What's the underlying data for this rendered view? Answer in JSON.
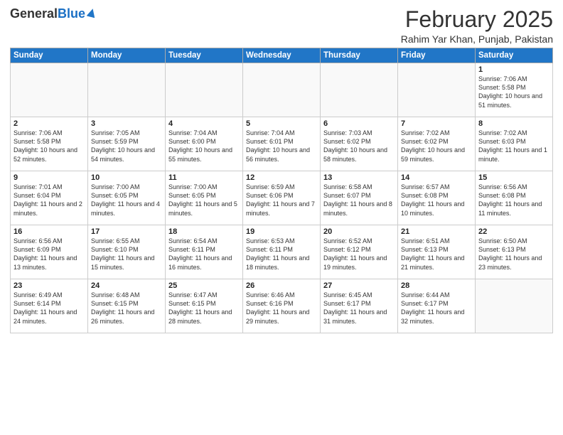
{
  "header": {
    "logo_general": "General",
    "logo_blue": "Blue",
    "month_title": "February 2025",
    "location": "Rahim Yar Khan, Punjab, Pakistan"
  },
  "weekdays": [
    "Sunday",
    "Monday",
    "Tuesday",
    "Wednesday",
    "Thursday",
    "Friday",
    "Saturday"
  ],
  "weeks": [
    [
      {
        "day": "",
        "sunrise": "",
        "sunset": "",
        "daylight": ""
      },
      {
        "day": "",
        "sunrise": "",
        "sunset": "",
        "daylight": ""
      },
      {
        "day": "",
        "sunrise": "",
        "sunset": "",
        "daylight": ""
      },
      {
        "day": "",
        "sunrise": "",
        "sunset": "",
        "daylight": ""
      },
      {
        "day": "",
        "sunrise": "",
        "sunset": "",
        "daylight": ""
      },
      {
        "day": "",
        "sunrise": "",
        "sunset": "",
        "daylight": ""
      },
      {
        "day": "1",
        "sunrise": "Sunrise: 7:06 AM",
        "sunset": "Sunset: 5:58 PM",
        "daylight": "Daylight: 10 hours and 51 minutes."
      }
    ],
    [
      {
        "day": "2",
        "sunrise": "Sunrise: 7:06 AM",
        "sunset": "Sunset: 5:58 PM",
        "daylight": "Daylight: 10 hours and 52 minutes."
      },
      {
        "day": "3",
        "sunrise": "Sunrise: 7:05 AM",
        "sunset": "Sunset: 5:59 PM",
        "daylight": "Daylight: 10 hours and 54 minutes."
      },
      {
        "day": "4",
        "sunrise": "Sunrise: 7:04 AM",
        "sunset": "Sunset: 6:00 PM",
        "daylight": "Daylight: 10 hours and 55 minutes."
      },
      {
        "day": "5",
        "sunrise": "Sunrise: 7:04 AM",
        "sunset": "Sunset: 6:01 PM",
        "daylight": "Daylight: 10 hours and 56 minutes."
      },
      {
        "day": "6",
        "sunrise": "Sunrise: 7:03 AM",
        "sunset": "Sunset: 6:02 PM",
        "daylight": "Daylight: 10 hours and 58 minutes."
      },
      {
        "day": "7",
        "sunrise": "Sunrise: 7:02 AM",
        "sunset": "Sunset: 6:02 PM",
        "daylight": "Daylight: 10 hours and 59 minutes."
      },
      {
        "day": "8",
        "sunrise": "Sunrise: 7:02 AM",
        "sunset": "Sunset: 6:03 PM",
        "daylight": "Daylight: 11 hours and 1 minute."
      }
    ],
    [
      {
        "day": "9",
        "sunrise": "Sunrise: 7:01 AM",
        "sunset": "Sunset: 6:04 PM",
        "daylight": "Daylight: 11 hours and 2 minutes."
      },
      {
        "day": "10",
        "sunrise": "Sunrise: 7:00 AM",
        "sunset": "Sunset: 6:05 PM",
        "daylight": "Daylight: 11 hours and 4 minutes."
      },
      {
        "day": "11",
        "sunrise": "Sunrise: 7:00 AM",
        "sunset": "Sunset: 6:05 PM",
        "daylight": "Daylight: 11 hours and 5 minutes."
      },
      {
        "day": "12",
        "sunrise": "Sunrise: 6:59 AM",
        "sunset": "Sunset: 6:06 PM",
        "daylight": "Daylight: 11 hours and 7 minutes."
      },
      {
        "day": "13",
        "sunrise": "Sunrise: 6:58 AM",
        "sunset": "Sunset: 6:07 PM",
        "daylight": "Daylight: 11 hours and 8 minutes."
      },
      {
        "day": "14",
        "sunrise": "Sunrise: 6:57 AM",
        "sunset": "Sunset: 6:08 PM",
        "daylight": "Daylight: 11 hours and 10 minutes."
      },
      {
        "day": "15",
        "sunrise": "Sunrise: 6:56 AM",
        "sunset": "Sunset: 6:08 PM",
        "daylight": "Daylight: 11 hours and 11 minutes."
      }
    ],
    [
      {
        "day": "16",
        "sunrise": "Sunrise: 6:56 AM",
        "sunset": "Sunset: 6:09 PM",
        "daylight": "Daylight: 11 hours and 13 minutes."
      },
      {
        "day": "17",
        "sunrise": "Sunrise: 6:55 AM",
        "sunset": "Sunset: 6:10 PM",
        "daylight": "Daylight: 11 hours and 15 minutes."
      },
      {
        "day": "18",
        "sunrise": "Sunrise: 6:54 AM",
        "sunset": "Sunset: 6:11 PM",
        "daylight": "Daylight: 11 hours and 16 minutes."
      },
      {
        "day": "19",
        "sunrise": "Sunrise: 6:53 AM",
        "sunset": "Sunset: 6:11 PM",
        "daylight": "Daylight: 11 hours and 18 minutes."
      },
      {
        "day": "20",
        "sunrise": "Sunrise: 6:52 AM",
        "sunset": "Sunset: 6:12 PM",
        "daylight": "Daylight: 11 hours and 19 minutes."
      },
      {
        "day": "21",
        "sunrise": "Sunrise: 6:51 AM",
        "sunset": "Sunset: 6:13 PM",
        "daylight": "Daylight: 11 hours and 21 minutes."
      },
      {
        "day": "22",
        "sunrise": "Sunrise: 6:50 AM",
        "sunset": "Sunset: 6:13 PM",
        "daylight": "Daylight: 11 hours and 23 minutes."
      }
    ],
    [
      {
        "day": "23",
        "sunrise": "Sunrise: 6:49 AM",
        "sunset": "Sunset: 6:14 PM",
        "daylight": "Daylight: 11 hours and 24 minutes."
      },
      {
        "day": "24",
        "sunrise": "Sunrise: 6:48 AM",
        "sunset": "Sunset: 6:15 PM",
        "daylight": "Daylight: 11 hours and 26 minutes."
      },
      {
        "day": "25",
        "sunrise": "Sunrise: 6:47 AM",
        "sunset": "Sunset: 6:15 PM",
        "daylight": "Daylight: 11 hours and 28 minutes."
      },
      {
        "day": "26",
        "sunrise": "Sunrise: 6:46 AM",
        "sunset": "Sunset: 6:16 PM",
        "daylight": "Daylight: 11 hours and 29 minutes."
      },
      {
        "day": "27",
        "sunrise": "Sunrise: 6:45 AM",
        "sunset": "Sunset: 6:17 PM",
        "daylight": "Daylight: 11 hours and 31 minutes."
      },
      {
        "day": "28",
        "sunrise": "Sunrise: 6:44 AM",
        "sunset": "Sunset: 6:17 PM",
        "daylight": "Daylight: 11 hours and 32 minutes."
      },
      {
        "day": "",
        "sunrise": "",
        "sunset": "",
        "daylight": ""
      }
    ]
  ]
}
